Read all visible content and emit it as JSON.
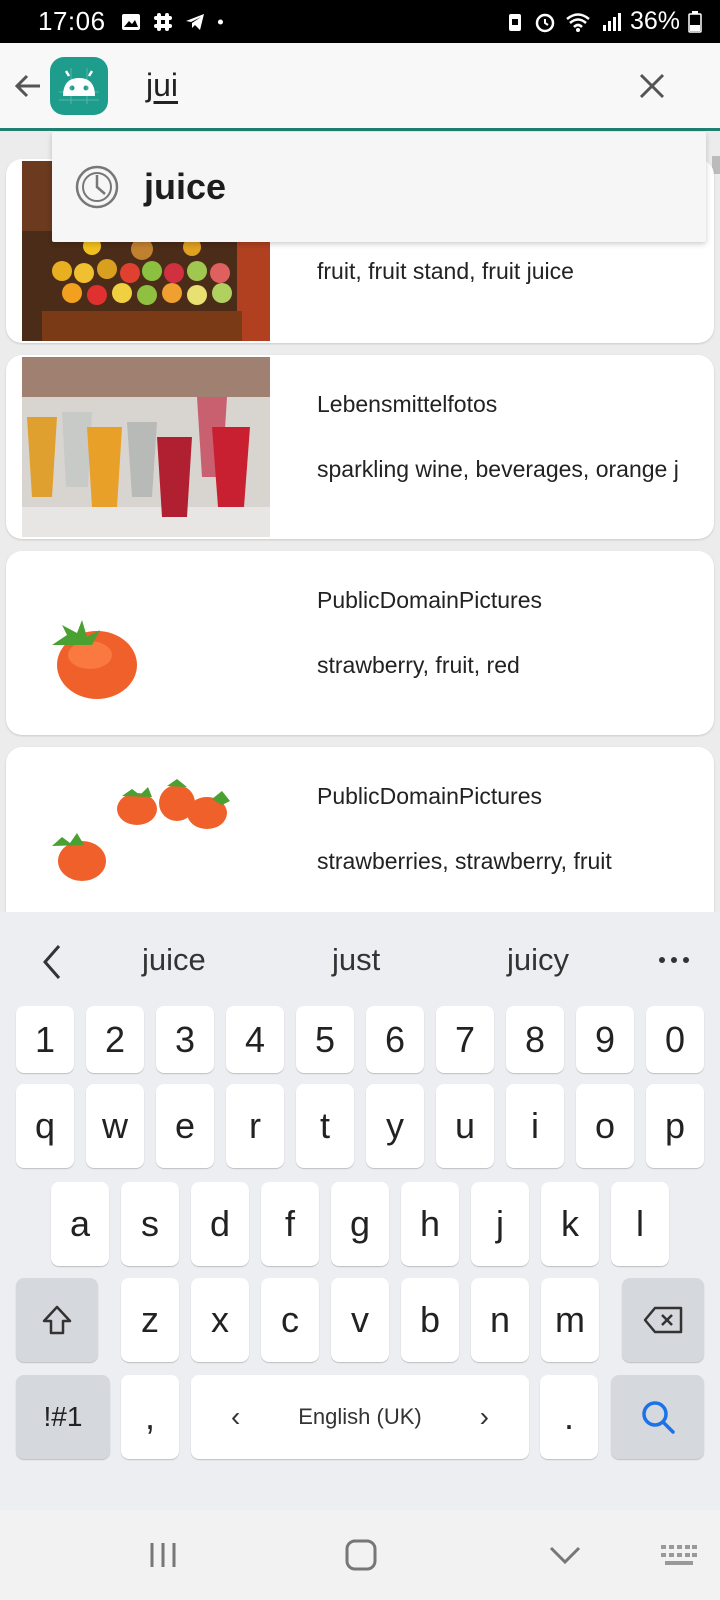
{
  "status_bar": {
    "time": "17:06",
    "battery": "36%",
    "icons": [
      "gallery-icon",
      "slack-icon",
      "telegram-icon",
      "dot-icon",
      "battery-saver-icon",
      "alarm-icon",
      "wifi-icon",
      "signal-icon",
      "battery-icon"
    ]
  },
  "app_bar": {
    "query": "jui",
    "back_icon": "arrow-back-icon",
    "clear_icon": "close-icon",
    "logo_icon": "android-app-icon",
    "accent_color": "#1f7f70"
  },
  "suggestion": {
    "text": "juice",
    "icon": "history-icon"
  },
  "results": [
    {
      "source": "",
      "tags": "fruit, fruit stand, fruit juice"
    },
    {
      "source": "Lebensmittelfotos",
      "tags": "sparkling wine, beverages, orange j"
    },
    {
      "source": "PublicDomainPictures",
      "tags": "strawberry, fruit, red"
    },
    {
      "source": "PublicDomainPictures",
      "tags": "strawberries, strawberry, fruit"
    }
  ],
  "keyboard": {
    "predictions": [
      "juice",
      "just",
      "juicy"
    ],
    "number_row": [
      "1",
      "2",
      "3",
      "4",
      "5",
      "6",
      "7",
      "8",
      "9",
      "0"
    ],
    "row1": [
      "q",
      "w",
      "e",
      "r",
      "t",
      "y",
      "u",
      "i",
      "o",
      "p"
    ],
    "row2": [
      "a",
      "s",
      "d",
      "f",
      "g",
      "h",
      "j",
      "k",
      "l"
    ],
    "row3": [
      "z",
      "x",
      "c",
      "v",
      "b",
      "n",
      "m"
    ],
    "symbols_key": "!#1",
    "comma_key": ",",
    "space_label": "English (UK)",
    "space_left": "‹",
    "space_right": "›",
    "period_key": ".",
    "search_key_color": "#1a73e8"
  },
  "nav_bar": {
    "items": [
      "recents-icon",
      "home-icon",
      "back-down-icon",
      "keyboard-icon"
    ]
  }
}
